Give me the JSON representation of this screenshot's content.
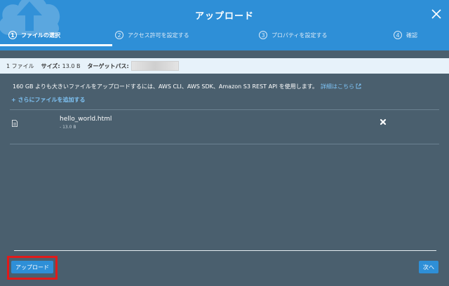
{
  "dialog": {
    "title": "アップロード",
    "steps": [
      {
        "num": "1",
        "label": "ファイルの選択"
      },
      {
        "num": "2",
        "label": "アクセス許可を設定する"
      },
      {
        "num": "3",
        "label": "プロパティを設定する"
      },
      {
        "num": "4",
        "label": "確認"
      }
    ]
  },
  "summary": {
    "file_count": "1 ファイル",
    "size_label": "サイズ:",
    "size_value": "13.0 B",
    "target_label": "ターゲットパス:"
  },
  "notice": {
    "text": "160 GB よりも大きいファイルをアップロードするには、AWS CLI、AWS SDK、Amazon S3 REST API を使用します。",
    "link": "詳細はこちら"
  },
  "add_files": "+ さらにファイルを追加する",
  "files": [
    {
      "name": "hello_world.html",
      "size": "- 13.0 B"
    }
  ],
  "footer": {
    "upload_button": "アップロード",
    "next_button": "次へ"
  },
  "colors": {
    "header": "#2e8fd7",
    "body": "#4a5f6e",
    "link": "#7ec3f5",
    "highlight": "#e11a1a"
  }
}
